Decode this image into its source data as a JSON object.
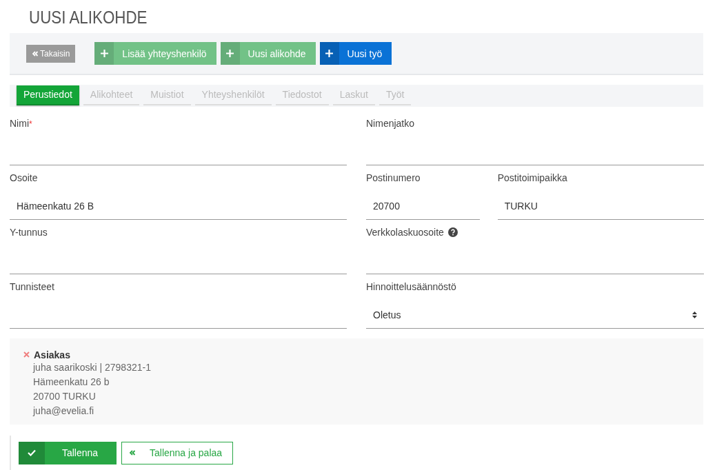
{
  "title": "UUSI ALIKOHDE",
  "toolbar": {
    "back": "Takaisin",
    "actions": [
      {
        "label": "Lisää yhteyshenkilö",
        "kind": "light"
      },
      {
        "label": "Uusi alikohde",
        "kind": "light"
      },
      {
        "label": "Uusi työ",
        "kind": "primary"
      }
    ]
  },
  "tabs": [
    {
      "label": "Perustiedot",
      "selected": true
    },
    {
      "label": "Alikohteet",
      "selected": false
    },
    {
      "label": "Muistiot",
      "selected": false
    },
    {
      "label": "Yhteyshenkilöt",
      "selected": false
    },
    {
      "label": "Tiedostot",
      "selected": false
    },
    {
      "label": "Laskut",
      "selected": false
    },
    {
      "label": "Työt",
      "selected": false
    }
  ],
  "rows": [
    {
      "left": {
        "label": "Nimi",
        "required_mark": "*",
        "kind": "text"
      },
      "right": [
        {
          "label": "Nimenjatko",
          "kind": "text"
        }
      ]
    },
    {
      "left": {
        "label": "Osoite",
        "value": "Hämeenkatu 26 B",
        "kind": "text"
      },
      "right": [
        {
          "label": "Postinumero",
          "value": "20700",
          "kind": "text"
        },
        {
          "label": "Postitoimipaikka",
          "value": "TURKU",
          "kind": "text"
        }
      ]
    },
    {
      "left": {
        "label": "Y-tunnus",
        "kind": "text"
      },
      "right": [
        {
          "label": "Verkkolaskuosoite",
          "help": true,
          "kind": "text"
        }
      ]
    },
    {
      "left": {
        "label": "Tunnisteet",
        "kind": "text"
      },
      "right": [
        {
          "label": "Hinnoittelusäännöstö",
          "value": "Oletus",
          "kind": "select"
        }
      ]
    }
  ],
  "customer": {
    "title": "Asiakas",
    "lines": [
      "juha saarikoski | 2798321-1",
      "Hämeenkatu 26 b",
      "20700 TURKU",
      "juha@evelia.fi"
    ]
  },
  "footer": [
    {
      "label": "Tallenna",
      "kind": "save"
    },
    {
      "label": "Tallenna ja palaa",
      "kind": "save-return"
    }
  ]
}
